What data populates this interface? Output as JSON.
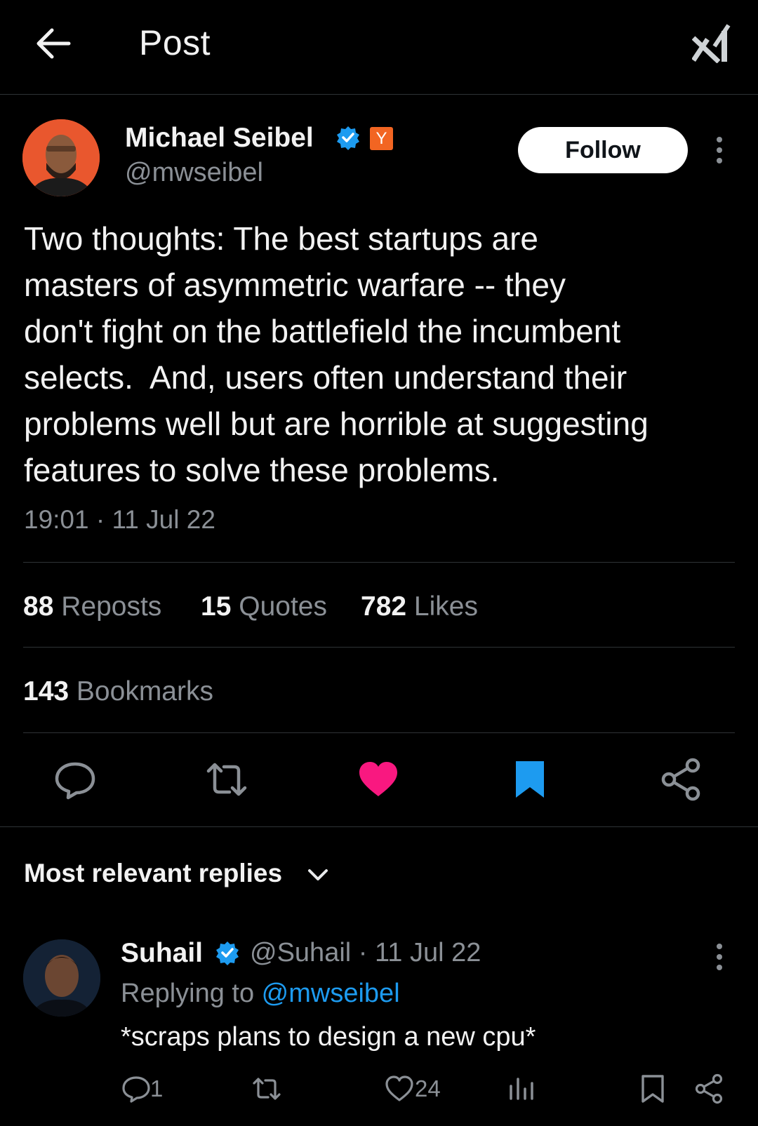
{
  "header": {
    "title": "Post"
  },
  "author": {
    "name": "Michael Seibel",
    "handle": "@mwseibel",
    "badge_letter": "Y",
    "follow_label": "Follow"
  },
  "tweet": {
    "text": "Two thoughts: The best startups are\nmasters of asymmetric warfare -- they\ndon't fight on the battlefield the incumbent\nselects.  And, users often understand their\nproblems well but are horrible at suggesting\nfeatures to solve these problems.",
    "timestamp": "19:01 · 11 Jul 22"
  },
  "stats": {
    "reposts_count": "88",
    "reposts_label": "Reposts",
    "quotes_count": "15",
    "quotes_label": "Quotes",
    "likes_count": "782",
    "likes_label": "Likes",
    "bookmarks_count": "143",
    "bookmarks_label": "Bookmarks"
  },
  "actions": {
    "icons": [
      "reply-icon",
      "repost-icon",
      "like-icon",
      "bookmark-icon",
      "share-icon"
    ],
    "liked": true,
    "bookmarked": true,
    "like_color": "#f91880",
    "bookmark_color": "#1d9bf0"
  },
  "replies": {
    "sort_label": "Most relevant replies",
    "items": [
      {
        "name": "Suhail",
        "handle_date": "@Suhail · 11 Jul 22",
        "replying_prefix": "Replying to ",
        "replying_to": "@mwseibel",
        "text": "*scraps plans to design a new cpu*",
        "reply_count": "1",
        "like_count": "24"
      }
    ]
  },
  "colors": {
    "background": "#000000",
    "text": "#e7e9ea",
    "muted": "#8b9096",
    "accent": "#1d9bf0",
    "yc_orange": "#f26522"
  }
}
